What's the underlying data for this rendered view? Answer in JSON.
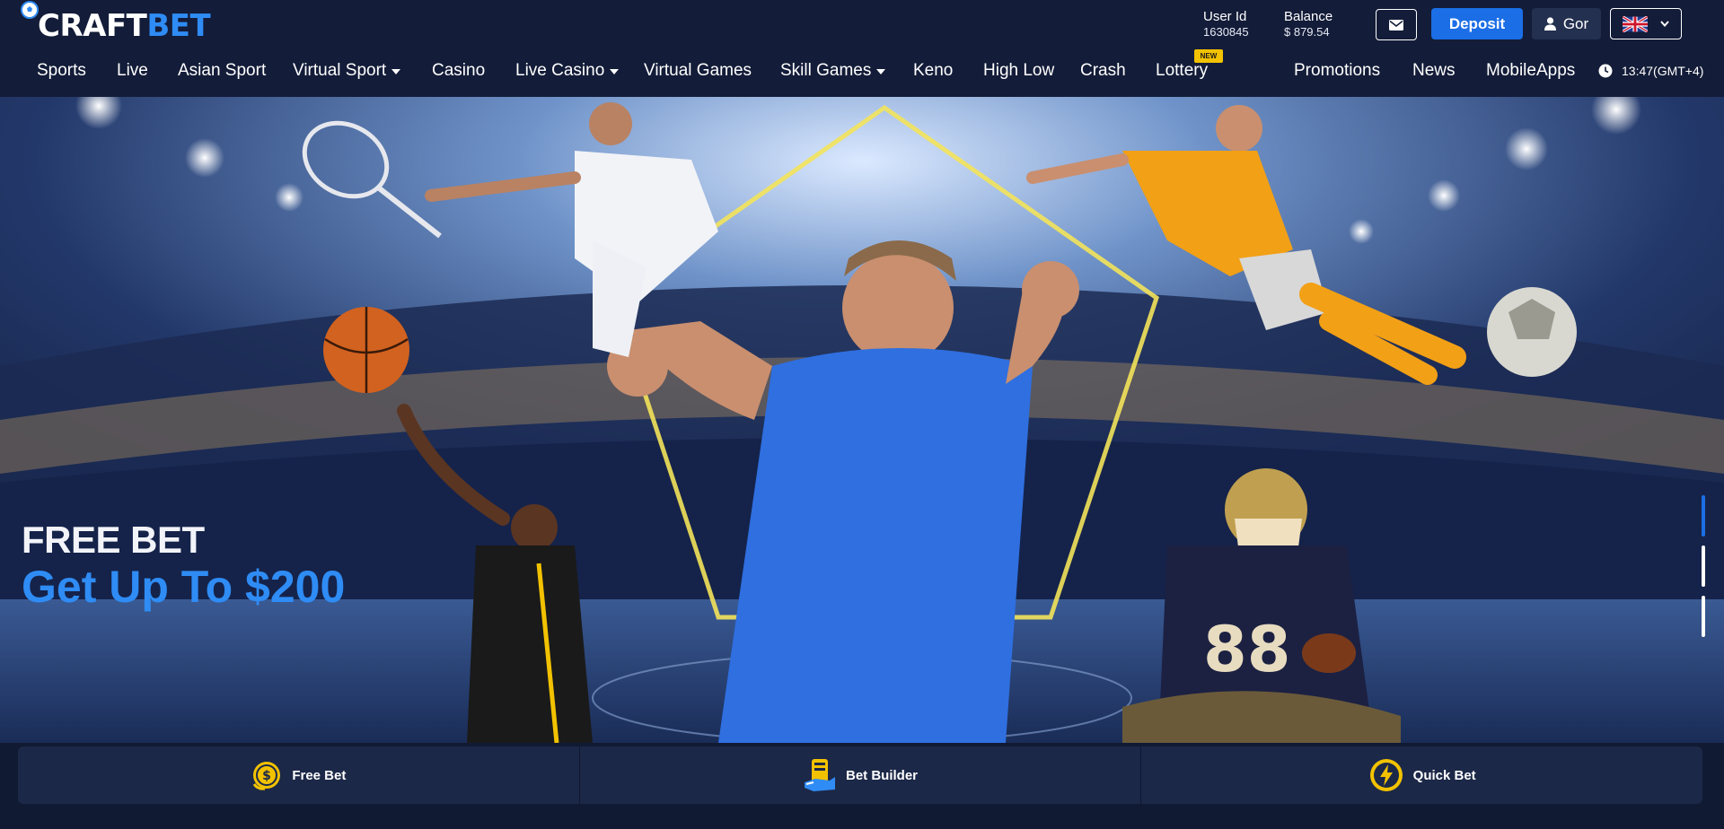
{
  "brand": {
    "part1": "CRAFT",
    "part2": "BET"
  },
  "user": {
    "id_label": "User Id",
    "id_value": "1630845",
    "balance_label": "Balance",
    "balance_value": "$ 879.54"
  },
  "header_buttons": {
    "mail_icon": "envelope-icon",
    "deposit": "Deposit",
    "user_name": "Gor",
    "language_flag": "uk-flag-icon"
  },
  "nav": {
    "items": [
      {
        "label": "Sports",
        "dropdown": false
      },
      {
        "label": "Live",
        "dropdown": false
      },
      {
        "label": "Asian Sport",
        "dropdown": false
      },
      {
        "label": "Virtual Sport",
        "dropdown": true
      },
      {
        "label": "Casino",
        "dropdown": false
      },
      {
        "label": "Live Casino",
        "dropdown": true
      },
      {
        "label": "Virtual Games",
        "dropdown": false
      },
      {
        "label": "Skill Games",
        "dropdown": true
      },
      {
        "label": "Keno",
        "dropdown": false
      },
      {
        "label": "High Low",
        "dropdown": false
      },
      {
        "label": "Crash",
        "dropdown": false
      },
      {
        "label": "Lottery",
        "dropdown": false
      }
    ],
    "right_items": [
      {
        "label": "Promotions"
      },
      {
        "label": "News"
      },
      {
        "label": "MobileApps"
      }
    ],
    "new_badge": "NEW",
    "time": "13:47(GMT+4)"
  },
  "banner": {
    "headline": "FREE BET",
    "subheadline": "Get Up To $200",
    "slides_count": 3,
    "active_slide": 1
  },
  "quick_links": [
    {
      "label": "Free Bet",
      "icon": "dollar-coin-icon"
    },
    {
      "label": "Bet Builder",
      "icon": "bet-builder-icon"
    },
    {
      "label": "Quick Bet",
      "icon": "lightning-icon"
    }
  ],
  "colors": {
    "header_bg": "#131c38",
    "accent_blue": "#2f8cf5",
    "deposit_blue": "#1b6ee6",
    "badge_yellow": "#f2c200",
    "quick_bar_bg": "#1c2848"
  }
}
